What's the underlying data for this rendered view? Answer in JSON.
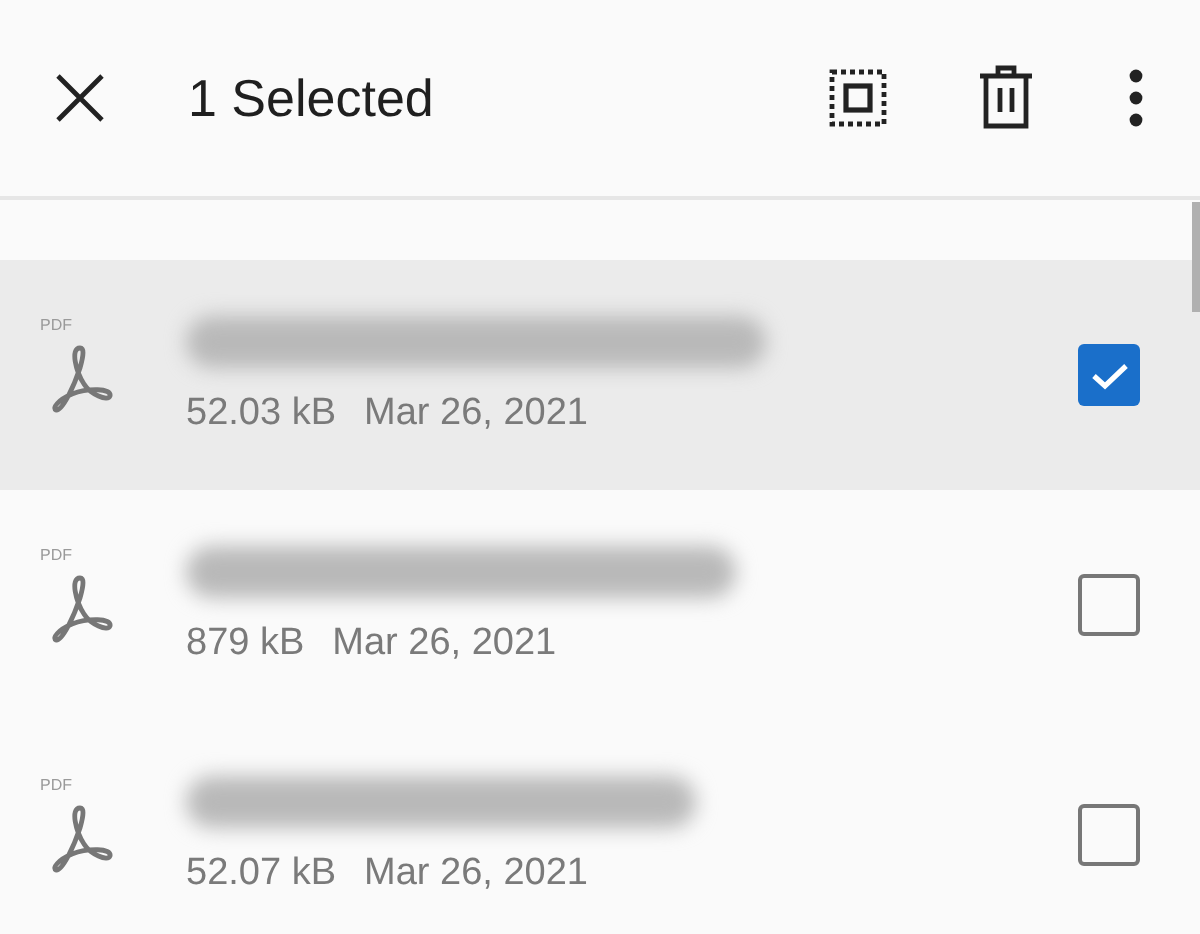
{
  "header": {
    "title": "1 Selected"
  },
  "files": [
    {
      "type_label": "PDF",
      "size": "52.03 kB",
      "date": "Mar 26, 2021",
      "selected": true
    },
    {
      "type_label": "PDF",
      "size": "879 kB",
      "date": "Mar 26, 2021",
      "selected": false
    },
    {
      "type_label": "PDF",
      "size": "52.07 kB",
      "date": "Mar 26, 2021",
      "selected": false
    }
  ]
}
